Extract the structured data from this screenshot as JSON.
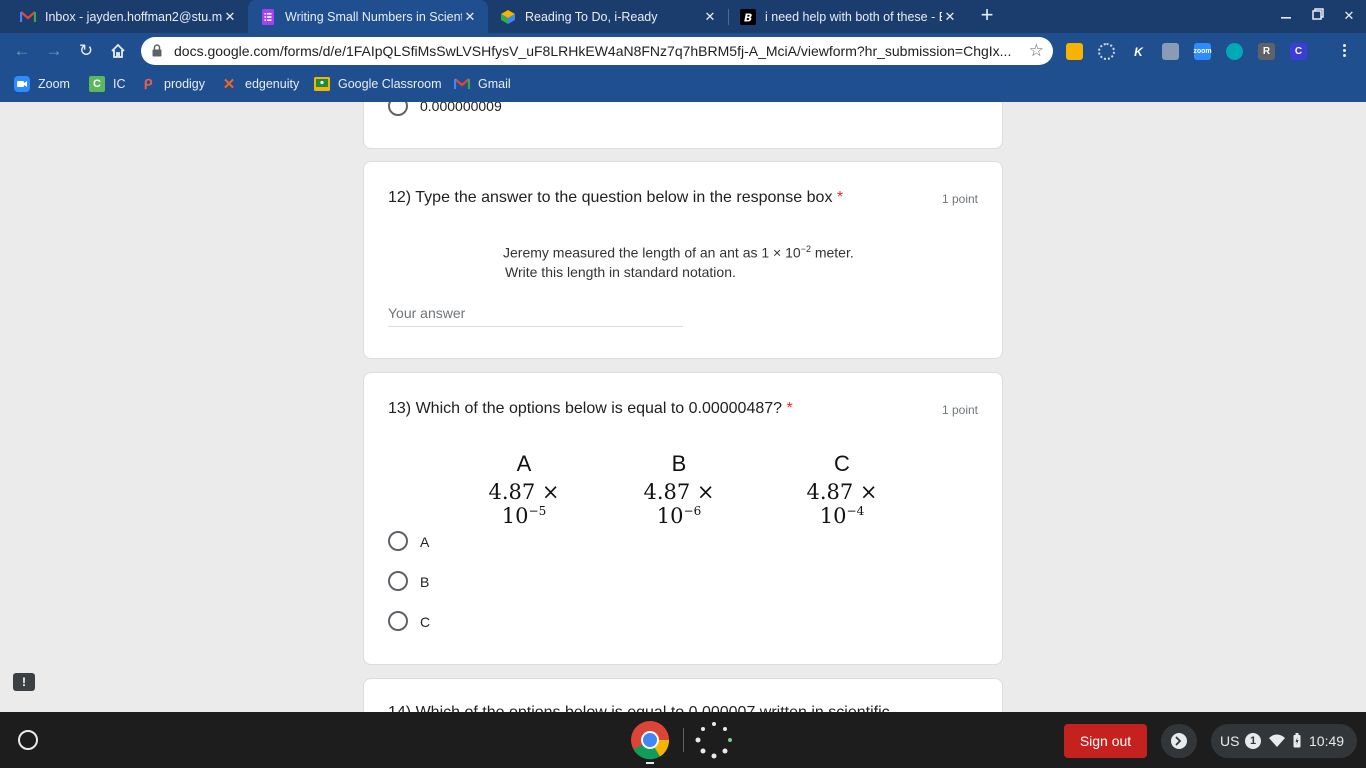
{
  "browser": {
    "tabs": [
      {
        "title": "Inbox - jayden.hoffman2@stu.m",
        "icon": "gmail-icon",
        "active": false
      },
      {
        "title": "Writing Small Numbers in Scient",
        "icon": "google-forms-icon",
        "active": true
      },
      {
        "title": "Reading To Do, i-Ready",
        "icon": "iready-icon",
        "active": false
      },
      {
        "title": "i need help with both of these - B",
        "icon": "brainly-icon",
        "active": false
      }
    ],
    "url": "docs.google.com/forms/d/e/1FAIpQLSfiMsSwLVSHfysV_uF8LRHkEW4aN8FNz7q7hBRM5fj-A_MciA/viewform?hr_submission=ChgIx...",
    "bookmarks": [
      "Zoom",
      "IC",
      "prodigy",
      "edgenuity",
      "Google Classroom",
      "Gmail"
    ],
    "extension_letters": {
      "k": "K",
      "r": "R",
      "c": "C"
    }
  },
  "form": {
    "prev_option_label": "0.000000009",
    "q12": {
      "title": "12) Type the answer to the question below in the response box",
      "required_mark": "*",
      "points": "1 point",
      "image_line1_prefix": "Jeremy measured the length of an ant as 1 × 10",
      "image_line1_exp": "−2",
      "image_line1_suffix": " meter.",
      "image_line2": "Write this length in standard notation.",
      "answer_placeholder": "Your answer"
    },
    "q13": {
      "title": "13) Which of the options below is equal to 0.00000487?",
      "required_mark": "*",
      "points": "1 point",
      "image_options": [
        {
          "letter": "A",
          "base": "4.87 × 10",
          "exp": "−5"
        },
        {
          "letter": "B",
          "base": "4.87 × 10",
          "exp": "−6"
        },
        {
          "letter": "C",
          "base": "4.87 × 10",
          "exp": "−4"
        }
      ],
      "choices": [
        "A",
        "B",
        "C"
      ]
    },
    "q14": {
      "title_partial": "14) Which of the options below is equal to 0.000007 written in scientific"
    }
  },
  "shelf": {
    "signout_label": "Sign out",
    "keyboard_layout": "US",
    "notification_count": "1",
    "time": "10:49"
  },
  "colors": {
    "tab_strip": "#1a3d6e",
    "toolbar": "#1f4f8f",
    "required": "#d93025",
    "signout": "#c5221f"
  }
}
